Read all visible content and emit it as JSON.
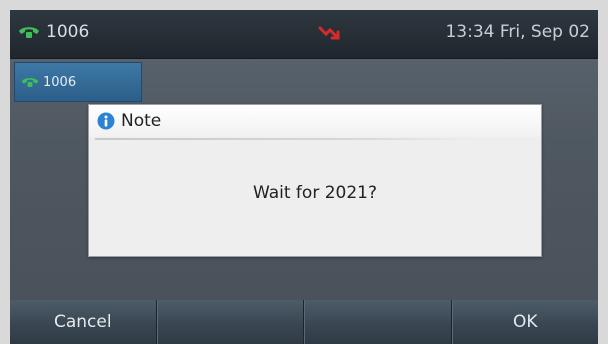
{
  "status_bar": {
    "account": "1006",
    "datetime": "13:34 Fri, Sep 02",
    "account_icon": "phone-handset-icon",
    "alert_icon": "missed-call-icon"
  },
  "line_key": {
    "label": "1006",
    "icon": "phone-handset-icon"
  },
  "dialog": {
    "title": "Note",
    "title_icon": "info-icon",
    "message": "Wait for 2021?"
  },
  "softkeys": [
    "Cancel",
    "",
    "",
    "OK"
  ],
  "colors": {
    "line_key_blue": "#2f6a97",
    "phone_icon_green": "#3fbf5a",
    "missed_call_red": "#d82a2a",
    "info_icon_blue": "#2c83d6"
  }
}
